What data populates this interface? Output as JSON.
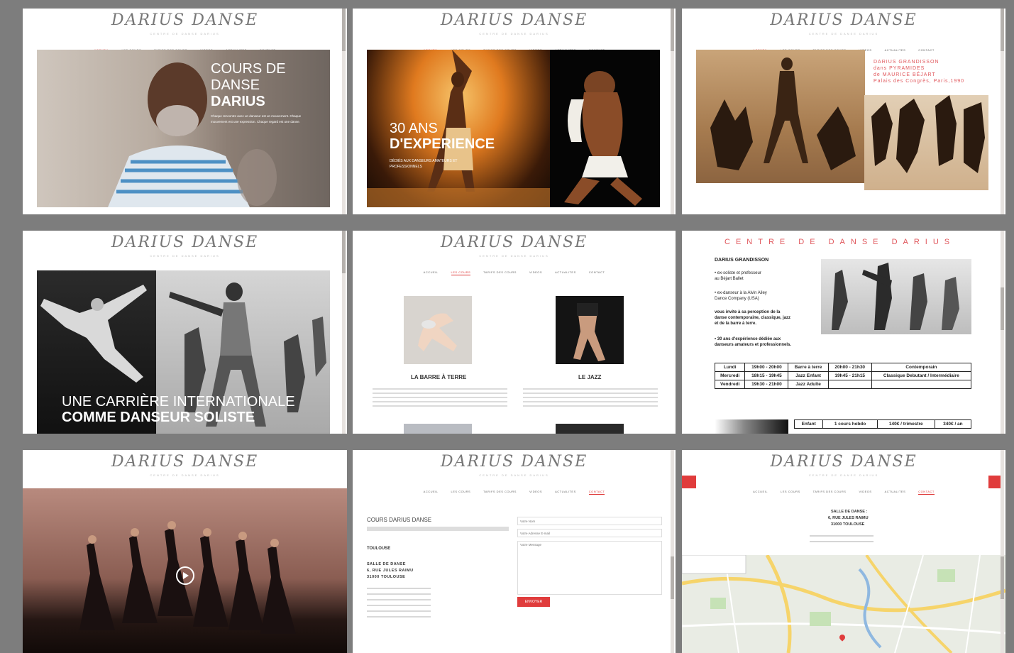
{
  "site": {
    "logo_text": "DARIUS DANSE",
    "logo_sub": "CENTRE DE DANSE DARIUS",
    "nav": [
      "ACCUEIL",
      "LES COURS",
      "TARIFS DES COURS",
      "VIDEOS",
      "ACTUALITES",
      "CONTACT"
    ]
  },
  "panel1": {
    "title_line1": "COURS DE",
    "title_line2": "DANSE",
    "title_line3": "DARIUS",
    "body": "Chaque rencontre avec un danseur est un mouvement. Chaque mouvement est une expression. Chaque regard est une danse."
  },
  "panel2": {
    "title_line1": "30 ANS",
    "title_line2": "D'EXPERIENCE",
    "sub_line1": "DÉDIÉS AUX DANSEURS AMATEURS ET",
    "sub_line2": "PROFESSIONNELS"
  },
  "panel3": {
    "caption": [
      "DARIUS GRANDISSON",
      "dans PYRAMIDES",
      "de MAURICE BÉJART",
      "Palais des Congrès, Paris,1990"
    ]
  },
  "panel4": {
    "line1": "UNE CARRIÈRE INTERNATIONALE",
    "line2": "COMME DANSEUR SOLISTE"
  },
  "panel5": {
    "course1": "LA BARRE À TERRE",
    "course2": "LE JAZZ"
  },
  "panel6": {
    "heading": "CENTRE DE DANSE DARIUS",
    "name": "DARIUS GRANDISSON",
    "bullet1a": "• ex-soliste et professeur",
    "bullet1b": "au Béjart Ballet",
    "bullet2a": "• ex-danseur à la Alvin Ailey",
    "bullet2b": "Dance Company (USA)",
    "invite": [
      "vous invite à sa perception de la",
      "danse contemporaine, classique, jazz",
      "et de la barre à terre."
    ],
    "exp": [
      "• 30 ans d'expérience dédiée aux",
      "danseurs amateurs et professionnels."
    ],
    "schedule": [
      [
        "Lundi",
        "19h00 - 20h00",
        "Barre à terre",
        "20h00 - 21h30",
        "Contemporain"
      ],
      [
        "Mercredi",
        "18h15 - 19h45",
        "Jazz Enfant",
        "19h45 - 21h15",
        "Classique Debutant / Intermédiaire"
      ],
      [
        "Vendredi",
        "19h30 - 21h00",
        "Jazz Adulte",
        "",
        ""
      ]
    ],
    "pricing": [
      "Enfant",
      "1 cours hebdo",
      "140€ / trimestre",
      "340€ / an"
    ]
  },
  "panel8": {
    "title": "COURS DARIUS DANSE",
    "section": "TOULOUSE",
    "address": [
      "SALLE DE DANSE",
      "6, RUE JULES RAIMU",
      "31000 TOULOUSE"
    ],
    "field1": "Votre Nom",
    "field2": "Votre Adresse E-mail",
    "field3": "Votre Message",
    "send": "ENVOYER"
  },
  "panel9": {
    "address": [
      "SALLE DE DANSE :",
      "6, RUE JULES RAIMU",
      "31000 TOULOUSE"
    ]
  },
  "colors": {
    "accent": "#d33a3a",
    "frame": "#7d7d7d"
  }
}
